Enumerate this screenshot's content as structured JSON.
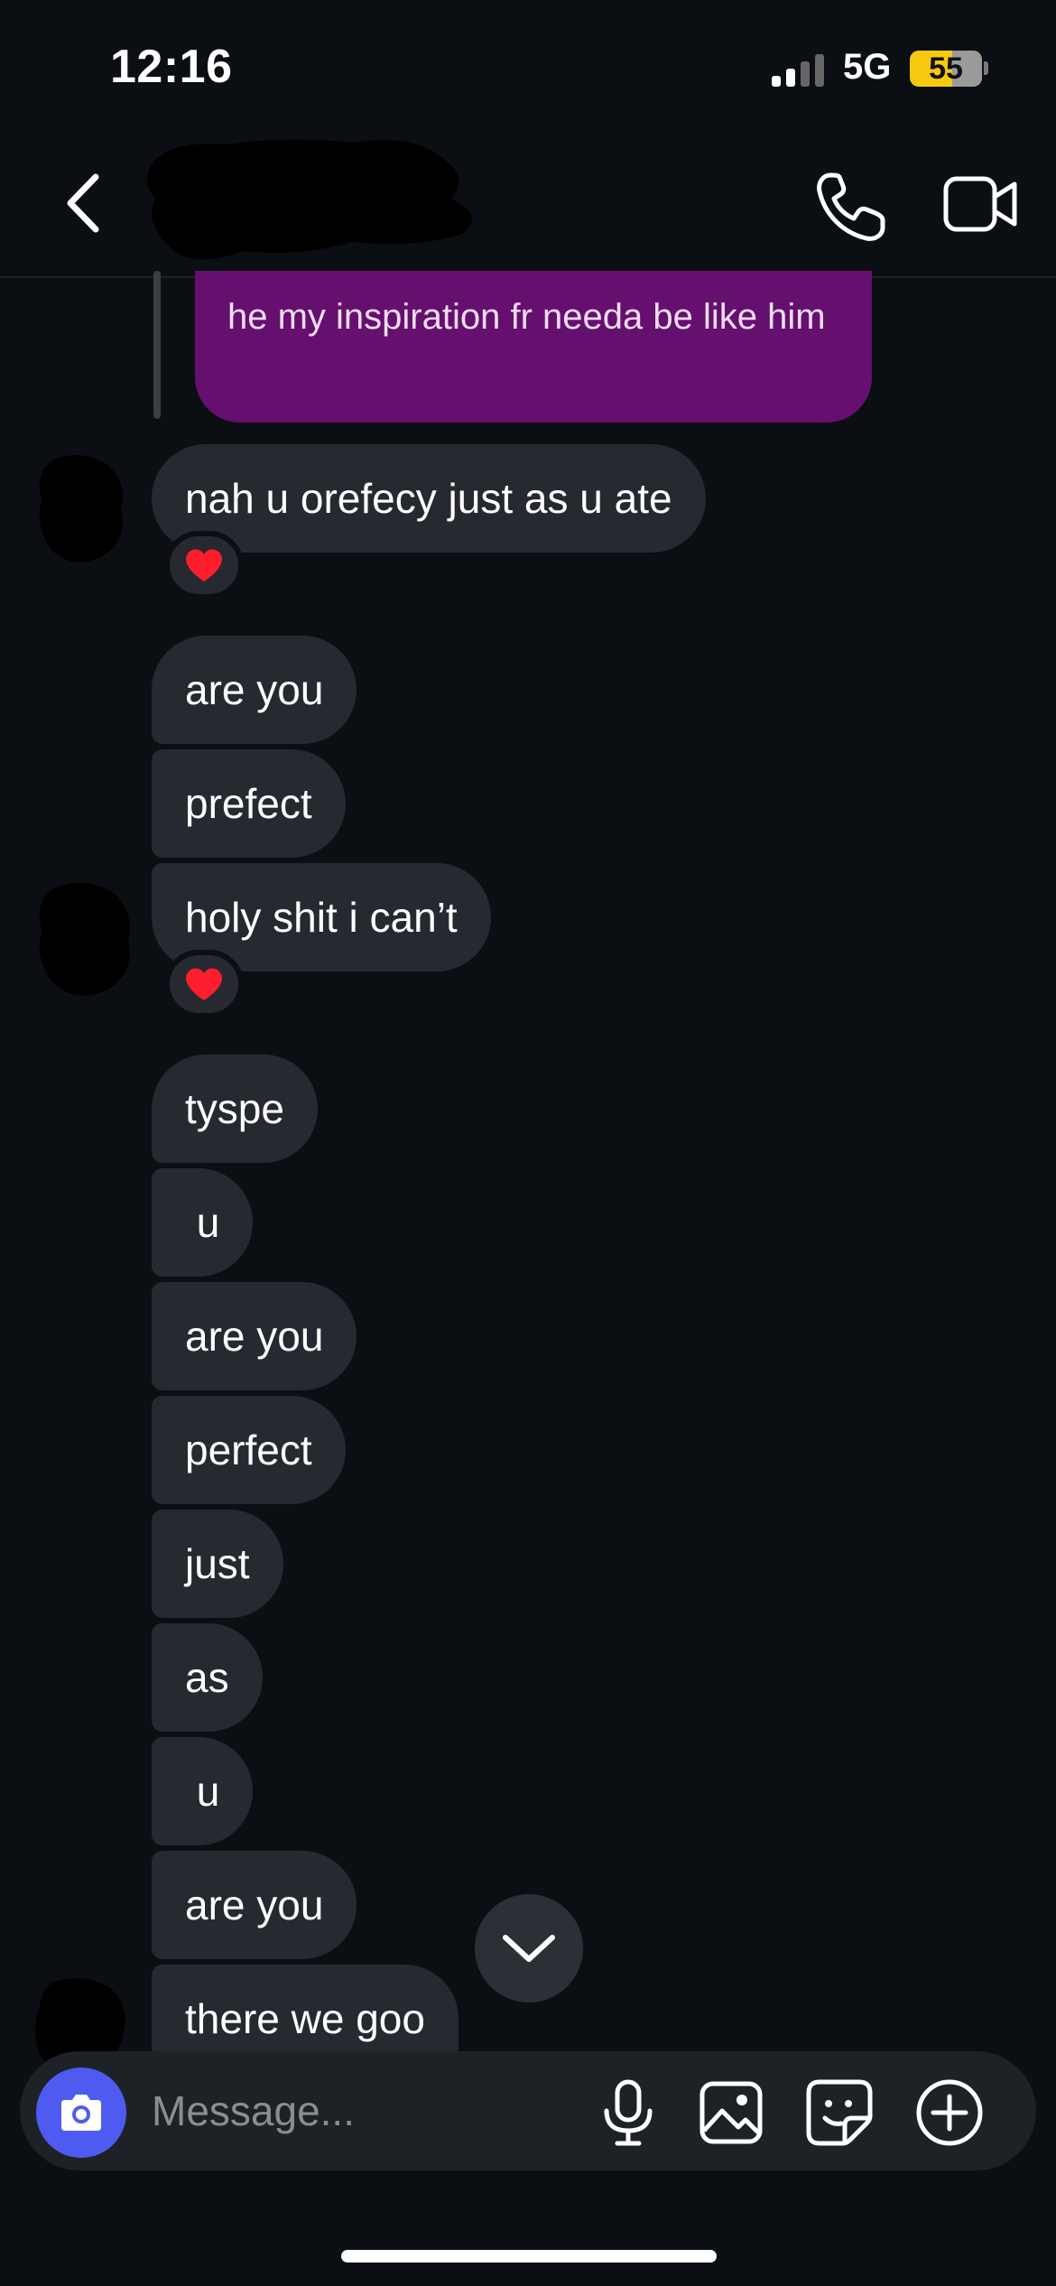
{
  "status_bar": {
    "time": "12:16",
    "network": "5G",
    "battery": "55"
  },
  "header": {
    "back_icon": "chevron-left-icon",
    "call_icon": "phone-icon",
    "video_icon": "video-camera-icon"
  },
  "messages": {
    "outgoing": "he my inspiration fr needa be like him",
    "incoming": [
      "nah u orefecy just as u ate",
      "are you",
      "prefect",
      "holy shit i can’t",
      "tyspe",
      " u",
      "are you",
      "perfect",
      "just",
      "as",
      " u",
      "are you",
      "there we goo"
    ],
    "reaction": "❤️"
  },
  "composer": {
    "placeholder": "Message...",
    "camera_icon": "camera-icon",
    "mic_icon": "microphone-icon",
    "gallery_icon": "image-icon",
    "sticker_icon": "sticker-icon",
    "plus_icon": "plus-circle-icon"
  },
  "colors": {
    "background": "#0b0e12",
    "incoming_bubble": "#262a30",
    "outgoing_bubble": "#650f6e",
    "accent": "#4f5bf0"
  }
}
